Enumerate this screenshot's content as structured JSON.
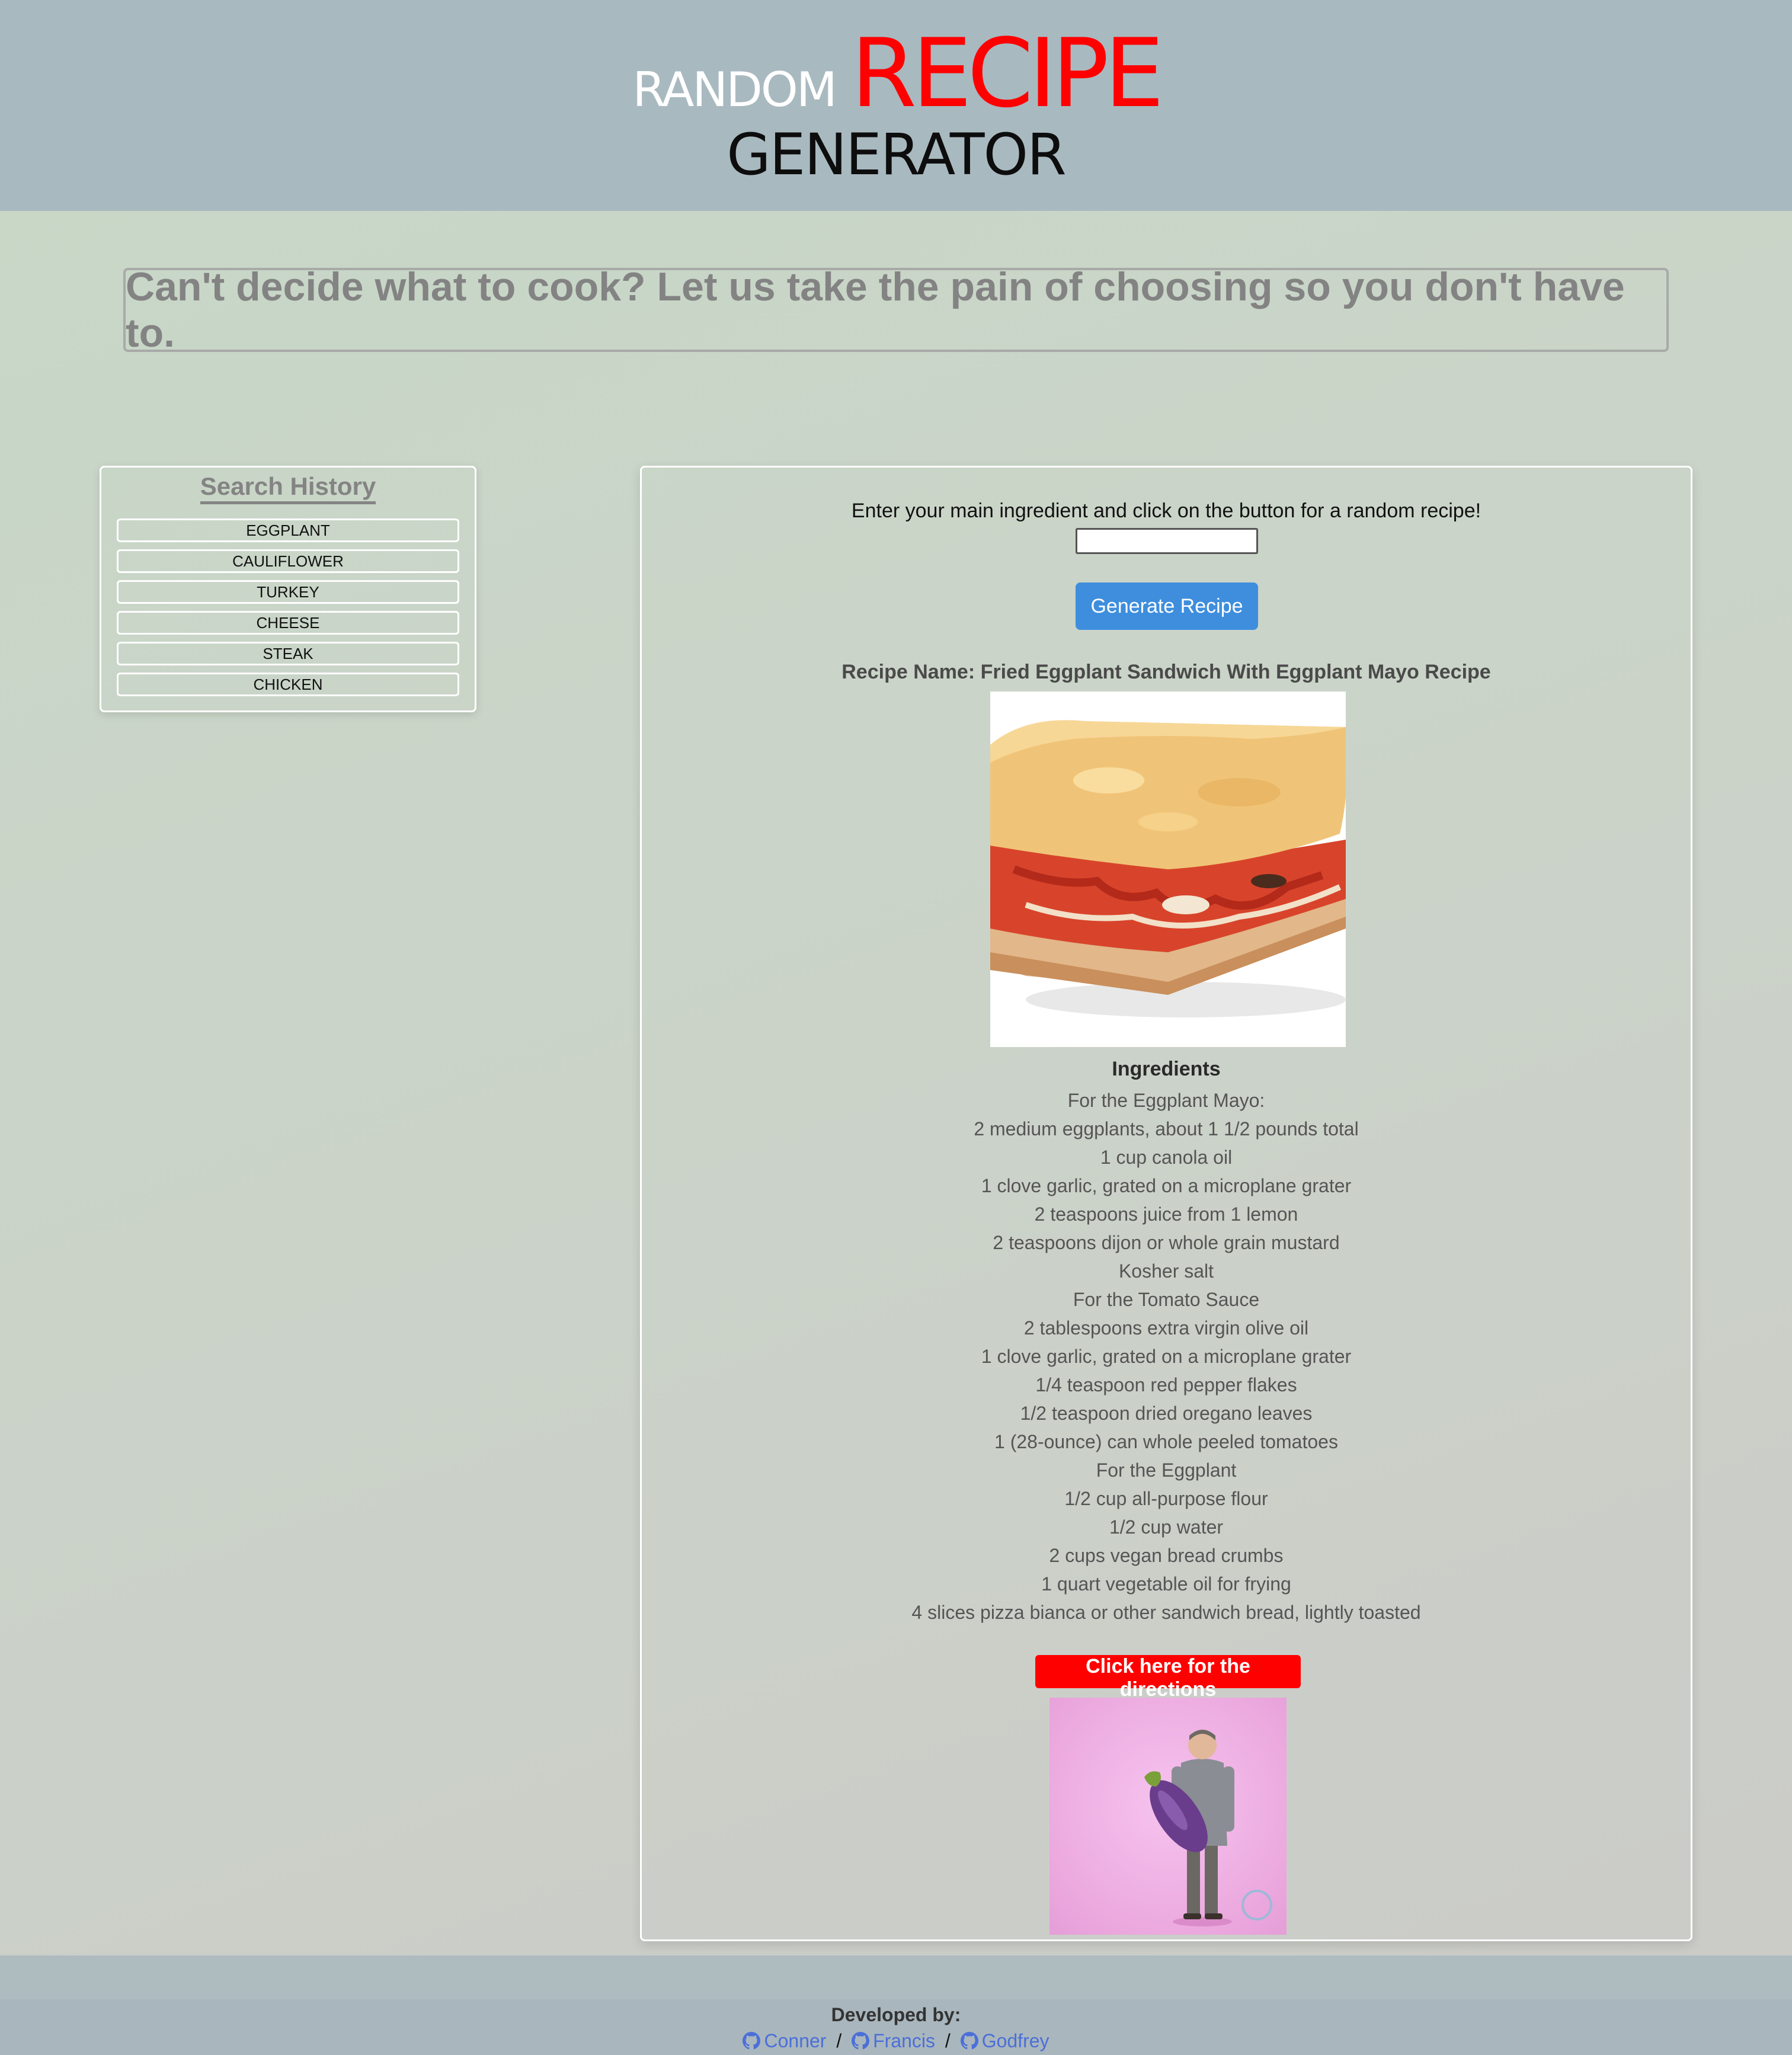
{
  "header": {
    "title_random": "RANDOM",
    "title_recipe": "RECIPE",
    "title_generator": "GENERATOR"
  },
  "tagline": "Can't decide what to cook? Let us take the pain of choosing so you don't have to.",
  "search_history": {
    "title": "Search History",
    "items": [
      "EGGPLANT",
      "CAULIFLOWER",
      "TURKEY",
      "CHEESE",
      "STEAK",
      "CHICKEN"
    ]
  },
  "main": {
    "prompt": "Enter your main ingredient and click on the button for a random recipe!",
    "input_value": "",
    "generate_label": "Generate Recipe",
    "recipe_name": "Recipe Name: Fried Eggplant Sandwich With Eggplant Mayo Recipe",
    "ingredients_heading": "Ingredients",
    "ingredients": [
      "For the Eggplant Mayo:",
      "2 medium eggplants, about 1 1/2 pounds total",
      "1 cup canola oil",
      "1 clove garlic, grated on a microplane grater",
      "2 teaspoons juice from 1 lemon",
      "2 teaspoons dijon or whole grain mustard",
      "Kosher salt",
      "For the Tomato Sauce",
      "2 tablespoons extra virgin olive oil",
      "1 clove garlic, grated on a microplane grater",
      "1/4 teaspoon red pepper flakes",
      "1/2 teaspoon dried oregano leaves",
      "1 (28-ounce) can whole peeled tomatoes",
      "For the Eggplant",
      "1/2 cup all-purpose flour",
      "1/2 cup water",
      "2 cups vegan bread crumbs",
      "1 quart vegetable oil for frying",
      "4 slices pizza bianca or other sandwich bread, lightly toasted"
    ],
    "directions_label": "Click here for the directions"
  },
  "footer": {
    "developed_by": "Developed by:",
    "developers": [
      "Conner",
      "Francis",
      "Godfrey"
    ],
    "separator": "/",
    "icon": "github-icon"
  },
  "colors": {
    "header_bg": "#a9b9c0",
    "recipe_red": "#ff0000",
    "button_blue": "#3e8edd",
    "link_blue": "#4b6fd9"
  }
}
